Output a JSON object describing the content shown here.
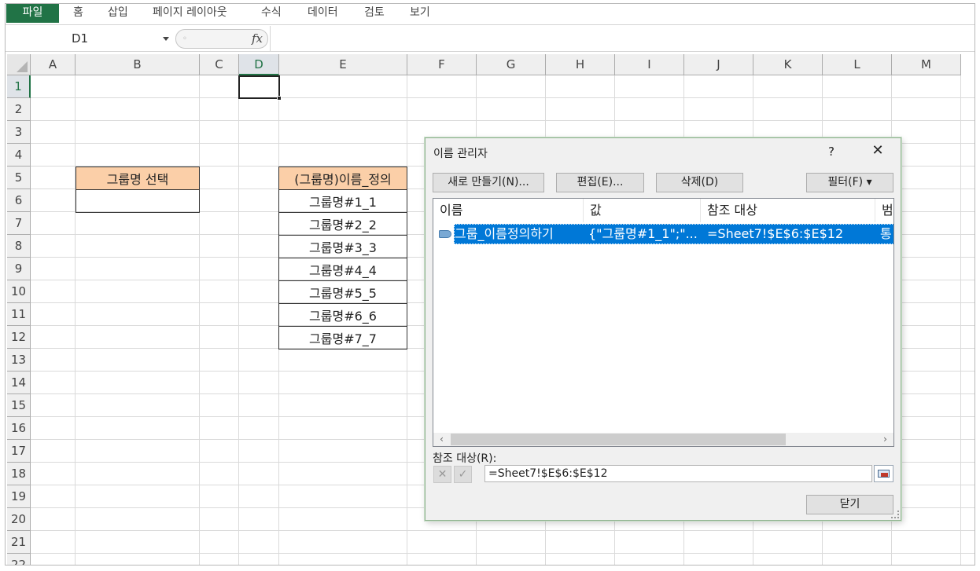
{
  "ribbon": {
    "tabs": [
      "파일",
      "홈",
      "삽입",
      "페이지 레이아웃",
      "수식",
      "데이터",
      "검토",
      "보기"
    ]
  },
  "formula_bar": {
    "name_box": "D1",
    "fx": "fx",
    "formula": ""
  },
  "sheet": {
    "columns": [
      "A",
      "B",
      "C",
      "D",
      "E",
      "F",
      "G",
      "H",
      "I",
      "J",
      "K",
      "L",
      "M"
    ],
    "rows": [
      "1",
      "2",
      "3",
      "4",
      "5",
      "6",
      "7",
      "8",
      "9",
      "10",
      "11",
      "12",
      "13",
      "14",
      "15",
      "16",
      "17",
      "18",
      "19",
      "20",
      "21",
      "22"
    ],
    "selected_cell": "D1",
    "b5_header": "그룹명 선택",
    "b6_value": "",
    "e5_header": "(그룹명)이름_정의",
    "e_values": [
      "그룹명#1_1",
      "그룹명#2_2",
      "그룹명#3_3",
      "그룹명#4_4",
      "그룹명#5_5",
      "그룹명#6_6",
      "그룹명#7_7"
    ]
  },
  "dialog": {
    "title": "이름 관리자",
    "help": "?",
    "close": "✕",
    "buttons": {
      "new": "새로 만들기(N)...",
      "edit": "편집(E)...",
      "delete": "삭제(D)",
      "filter": "필터(F) ▾"
    },
    "list_headers": [
      "이름",
      "값",
      "참조 대상",
      "범"
    ],
    "selected_row": {
      "name": "그룹_이름정의하기",
      "value": "{\"그룹명#1_1\";\"...",
      "refers_to": "=Sheet7!$E$6:$E$12",
      "scope": "통"
    },
    "refers_to_label": "참조 대상(R):",
    "refers_to_value": "=Sheet7!$E$6:$E$12",
    "cancel_mark": "✕",
    "confirm_mark": "✓",
    "close_button": "닫기"
  }
}
